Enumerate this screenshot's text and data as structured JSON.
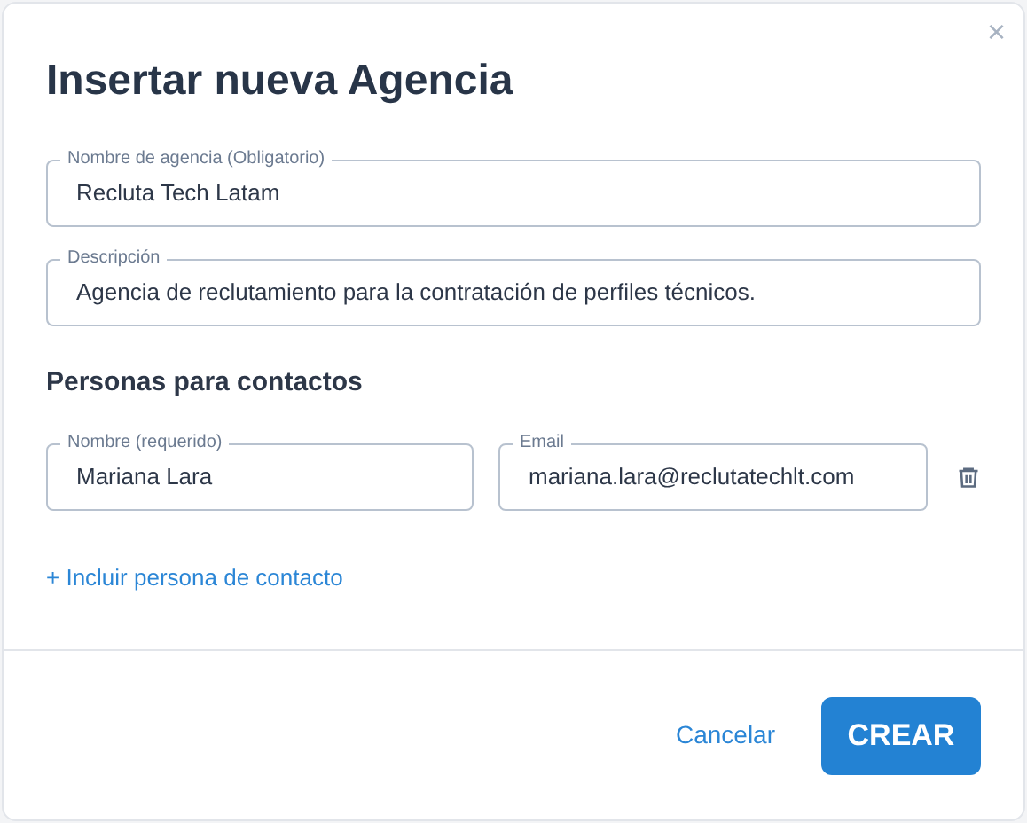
{
  "dialog": {
    "title": "Insertar nueva Agencia",
    "close": "×"
  },
  "fields": [
    {
      "label": "Nombre de agencia (Obligatorio)",
      "value": "Recluta Tech Latam"
    },
    {
      "label": "Descripción",
      "value": "Agencia de reclutamiento para la contratación de perfiles técnicos."
    }
  ],
  "contacts": {
    "heading": "Personas para contactos",
    "rows": [
      {
        "name": {
          "label": "Nombre (requerido)",
          "value": "Mariana Lara"
        },
        "email": {
          "label": "Email",
          "value": "mariana.lara@reclutatechlt.com"
        }
      }
    ],
    "add_link": "+ Incluir persona de contacto"
  },
  "footer": {
    "cancel": "Cancelar",
    "submit": "CREAR"
  }
}
